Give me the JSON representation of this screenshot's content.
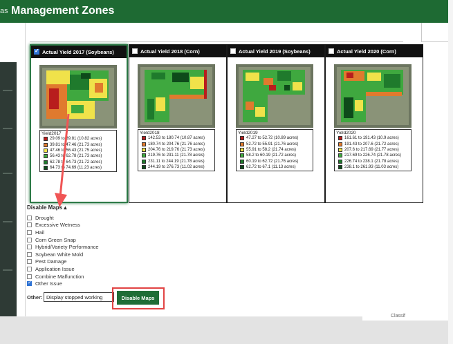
{
  "header": {
    "prev_text": "as",
    "title": "Management Zones"
  },
  "cards": [
    {
      "title": "Actual Yield 2017 (Soybeans)",
      "checked": true,
      "legend_title": "Yield2017",
      "legend": [
        {
          "label": "29.09 to 39.81 (10.82 acres)",
          "color": "#b81d1d"
        },
        {
          "label": "39.81 to 47.46 (21.73 acres)",
          "color": "#e07a2e"
        },
        {
          "label": "47.46 to 56.43 (21.75 acres)",
          "color": "#f0e24a"
        },
        {
          "label": "56.43 to 62.78 (21.73 acres)",
          "color": "#3fa83f"
        },
        {
          "label": "62.78 to 64.73 (21.72 acres)",
          "color": "#1f7a2c"
        },
        {
          "label": "64.73 to 74.69 (11.23 acres)",
          "color": "#0e4a1a"
        }
      ]
    },
    {
      "title": "Actual Yield 2018 (Corn)",
      "checked": false,
      "legend_title": "Yield2018",
      "legend": [
        {
          "label": "142.53 to 180.74 (10.87 acres)",
          "color": "#b81d1d"
        },
        {
          "label": "180.74 to 204.76 (21.76 acres)",
          "color": "#e07a2e"
        },
        {
          "label": "204.76 to 219.76 (21.73 acres)",
          "color": "#f0e24a"
        },
        {
          "label": "219.76 to 231.11 (21.78 acres)",
          "color": "#3fa83f"
        },
        {
          "label": "231.11 to 244.19 (21.78 acres)",
          "color": "#1f7a2c"
        },
        {
          "label": "244.19 to 276.73 (11.02 acres)",
          "color": "#0e4a1a"
        }
      ]
    },
    {
      "title": "Actual Yield 2019 (Soybeans)",
      "checked": false,
      "legend_title": "Yield2019",
      "legend": [
        {
          "label": "47.27 to 52.72 (10.89 acres)",
          "color": "#b81d1d"
        },
        {
          "label": "52.72 to 55.91 (21.76 acres)",
          "color": "#e07a2e"
        },
        {
          "label": "55.91 to 58.2 (21.74 acres)",
          "color": "#f0e24a"
        },
        {
          "label": "58.2 to 60.19 (21.72 acres)",
          "color": "#3fa83f"
        },
        {
          "label": "60.19 to 62.72 (21.76 acres)",
          "color": "#1f7a2c"
        },
        {
          "label": "62.72 to 67.1 (11.13 acres)",
          "color": "#0e4a1a"
        }
      ]
    },
    {
      "title": "Actual Yield 2020 (Corn)",
      "checked": false,
      "legend_title": "Yield2020",
      "legend": [
        {
          "label": "161.61 to 191.43 (10.9 acres)",
          "color": "#b81d1d"
        },
        {
          "label": "191.43 to 207.6 (21.72 acres)",
          "color": "#e07a2e"
        },
        {
          "label": "207.6 to 217.69 (21.77 acres)",
          "color": "#f0e24a"
        },
        {
          "label": "217.69 to 226.74 (21.78 acres)",
          "color": "#3fa83f"
        },
        {
          "label": "226.74 to 238.1 (21.78 acres)",
          "color": "#1f7a2c"
        },
        {
          "label": "238.1 to 261.93 (11.03 acres)",
          "color": "#0e4a1a"
        }
      ]
    }
  ],
  "disable_section": {
    "title": "Disable Maps ▴",
    "issues": [
      {
        "label": "Drought",
        "checked": false
      },
      {
        "label": "Excessive Wetness",
        "checked": false
      },
      {
        "label": "Hail",
        "checked": false
      },
      {
        "label": "Corn Green Snap",
        "checked": false
      },
      {
        "label": "Hybrid/Variety Performance",
        "checked": false
      },
      {
        "label": "Soybean White Mold",
        "checked": false
      },
      {
        "label": "Pest Damage",
        "checked": false
      },
      {
        "label": "Application Issue",
        "checked": false
      },
      {
        "label": "Combine Malfunction",
        "checked": false
      },
      {
        "label": "Other Issue",
        "checked": true
      }
    ],
    "other_label": "Other:",
    "other_value": "Display stopped working",
    "button_label": "Disable Maps"
  },
  "footer": {
    "clipped_text": "Classif"
  },
  "colors": {
    "header_green": "#1e6a33",
    "button_green": "#1f6d36",
    "highlight_red": "#e14343",
    "arrow_red": "#f05555"
  }
}
